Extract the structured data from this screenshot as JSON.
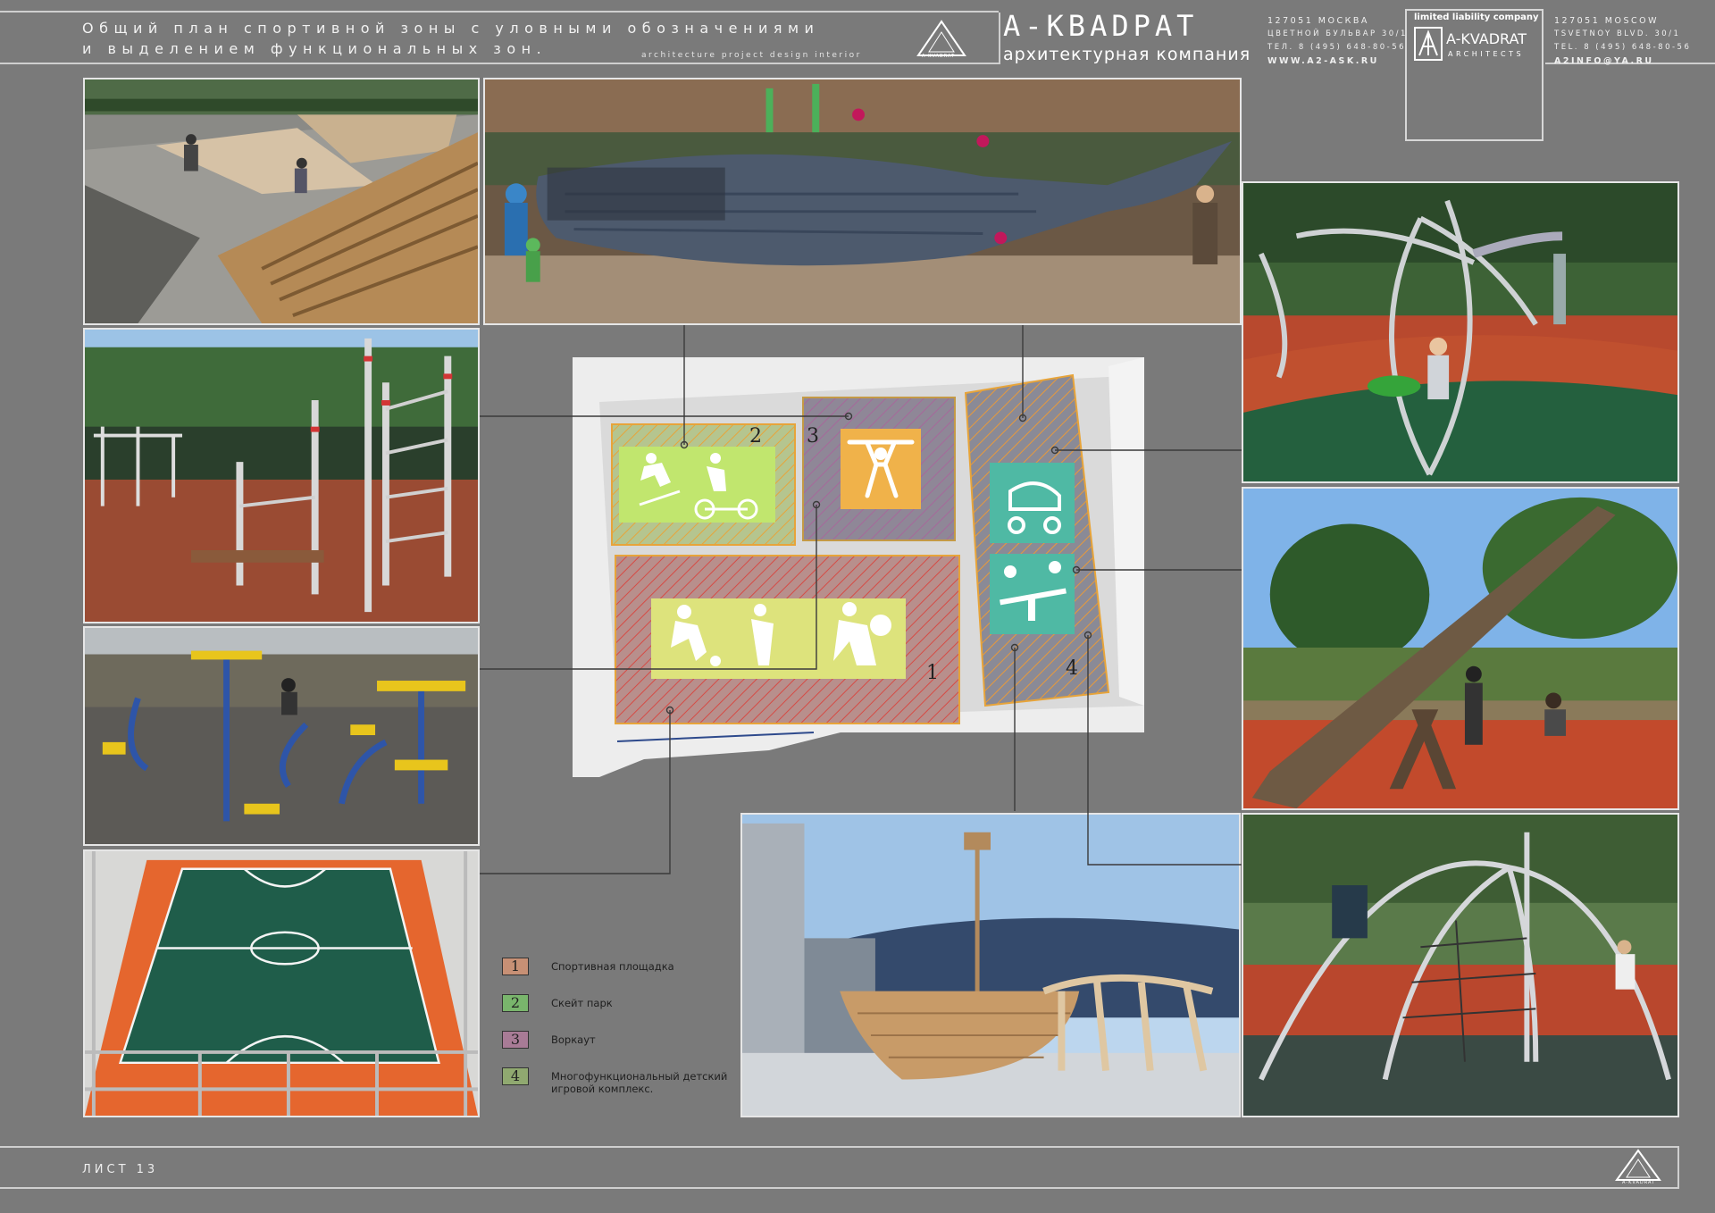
{
  "header": {
    "title_line1": "Общий план спортивной зоны с уловными обозначениями",
    "title_line2": "и выделением функциональных зон.",
    "subtitle": "architecture   project   design   interior",
    "logo_text": "A-KVADRAT",
    "brand_big": "A-KBADPAT",
    "brand_small": "архитектурная компания",
    "contact_ru": [
      "127051 МОСКВА",
      "ЦВЕТНОЙ БУЛЬВАР 30/1",
      "ТЕЛ. 8 (495) 648-80-56",
      "WWW.A2-ASK.RU"
    ],
    "contact_en": [
      "127051 MOSCOW",
      "TSVETNOY BLVD. 30/1",
      "TEL. 8 (495) 648-80-56",
      "A2INFO@YA.RU"
    ],
    "llc_top": "limited liability company",
    "llc_name": "A-KVADRAT",
    "llc_arch": "ARCHITECTS"
  },
  "photos": [
    {
      "name": "skatepark-photo",
      "caption": "skatepark with wooden ramps"
    },
    {
      "name": "whale-playground-photo",
      "caption": "whale-shaped climbing structure"
    },
    {
      "name": "workout-bars-photo",
      "caption": "workout bars area"
    },
    {
      "name": "outdoor-gym-photo",
      "caption": "outdoor fitness equipment"
    },
    {
      "name": "sports-court-photo",
      "caption": "multi-sport court"
    },
    {
      "name": "spider-climber-photo",
      "caption": "rope climbing dome"
    },
    {
      "name": "seesaw-photo",
      "caption": "large wooden seesaw"
    },
    {
      "name": "ship-playground-photo",
      "caption": "wooden pirate ship"
    },
    {
      "name": "rope-net-photo",
      "caption": "rope net playground"
    }
  ],
  "plan": {
    "zone_labels": [
      "1",
      "2",
      "3",
      "4"
    ],
    "colors": {
      "sport": "#e7a7a1",
      "skate": "#c1e66e",
      "workout": "#f0b24a",
      "kids": "#4fb9a4",
      "zone4_hatch": "#e8a23d",
      "ball_panel": "#dde37c"
    }
  },
  "legend": [
    {
      "num": "1",
      "label": "Спортивная площадка",
      "bg": "#c79075"
    },
    {
      "num": "2",
      "label": "Скейт парк",
      "bg": "#79b56c"
    },
    {
      "num": "3",
      "label": "Воркаут",
      "bg": "#a87b96"
    },
    {
      "num": "4",
      "label": "Многофункциональный детский",
      "label2": "игровой комплекс.",
      "bg": "#90a970"
    }
  ],
  "footer": {
    "sheet": "ЛИСТ 13",
    "logo_text": "A-KVADRAT"
  }
}
